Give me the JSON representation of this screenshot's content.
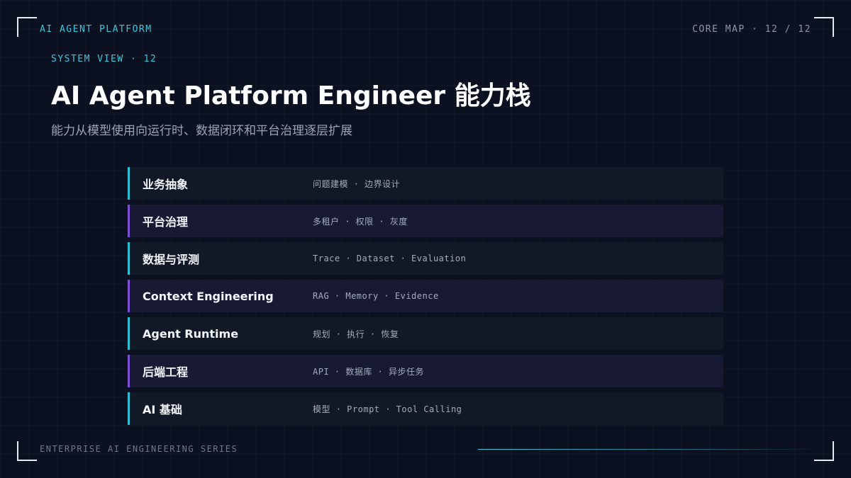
{
  "header": {
    "brand": "AI AGENT PLATFORM",
    "page_indicator": "CORE MAP · 12 / 12"
  },
  "hero": {
    "eyebrow": "SYSTEM VIEW · 12",
    "title": "AI Agent Platform Engineer 能力栈",
    "subtitle": "能力从模型使用向运行时、数据闭环和平台治理逐层扩展"
  },
  "stack": {
    "layers": [
      {
        "name": "业务抽象",
        "items": "问题建模 · 边界设计",
        "accent": "#2bbfd6"
      },
      {
        "name": "平台治理",
        "items": "多租户 · 权限 · 灰度",
        "accent": "#7d4fd6"
      },
      {
        "name": "数据与评测",
        "items": "Trace · Dataset · Evaluation",
        "accent": "#2bbfd6"
      },
      {
        "name": "Context Engineering",
        "items": "RAG · Memory · Evidence",
        "accent": "#7d4fd6"
      },
      {
        "name": "Agent Runtime",
        "items": "规划 · 执行 · 恢复",
        "accent": "#2bbfd6"
      },
      {
        "name": "后端工程",
        "items": "API · 数据库 · 异步任务",
        "accent": "#7d4fd6"
      },
      {
        "name": "AI 基础",
        "items": "模型 · Prompt · Tool Calling",
        "accent": "#2bbfd6"
      }
    ]
  },
  "footer": {
    "series": "ENTERPRISE AI ENGINEERING SERIES"
  },
  "colors": {
    "background": "#0b1120",
    "accent_cyan": "#39c6dc",
    "accent_purple": "#7d4fd6"
  }
}
